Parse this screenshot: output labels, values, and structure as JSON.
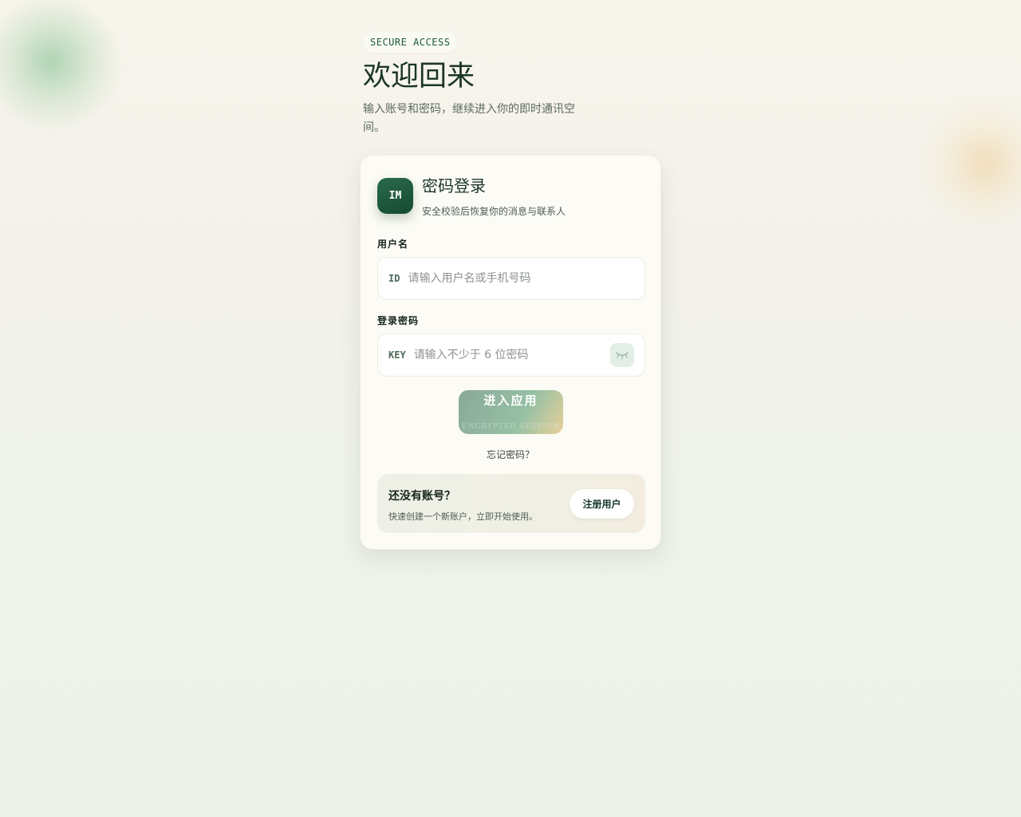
{
  "hero": {
    "badge": "SECURE ACCESS",
    "title": "欢迎回来",
    "subtitle": "输入账号和密码，继续进入你的即时通讯空间。"
  },
  "card": {
    "logo_text": "IM",
    "title": "密码登录",
    "subtitle": "安全校验后恢复你的消息与联系人",
    "username": {
      "label": "用户名",
      "prefix": "ID",
      "placeholder": "请输入用户名或手机号码",
      "value": ""
    },
    "password": {
      "label": "登录密码",
      "prefix": "KEY",
      "placeholder": "请输入不少于 6 位密码",
      "value": "",
      "toggle_icon": "eye-closed-icon"
    },
    "submit": {
      "label": "进入应用",
      "caption": "ENCRYPTED SESSION"
    },
    "forgot_link": "忘记密码？",
    "register": {
      "title": "还没有账号？",
      "subtitle": "快速创建一个新账户，立即开始使用。",
      "button": "注册用户"
    }
  },
  "colors": {
    "brand": "#1d5a3e",
    "card_bg": "#fcfbf5",
    "button_gradient_start": "#8aa898",
    "button_gradient_end": "#e7d09a"
  }
}
